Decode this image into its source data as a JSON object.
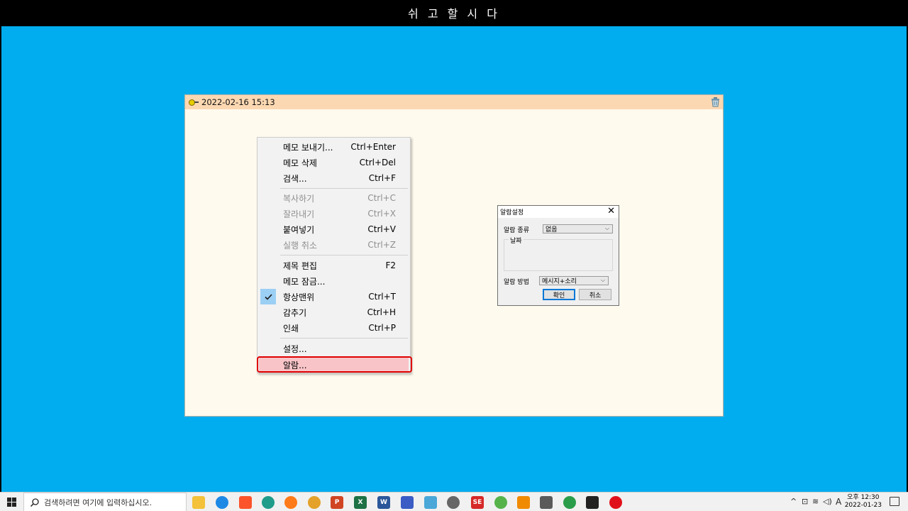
{
  "banner": {
    "title": "쉬 고 할 시 다"
  },
  "memo": {
    "date": "2022-02-16 15:13"
  },
  "context_menu": {
    "items": [
      {
        "label": "메모 보내기...",
        "shortcut": "Ctrl+Enter"
      },
      {
        "label": "메모 삭제",
        "shortcut": "Ctrl+Del"
      },
      {
        "label": "검색...",
        "shortcut": "Ctrl+F"
      },
      {
        "label": "복사하기",
        "shortcut": "Ctrl+C"
      },
      {
        "label": "잘라내기",
        "shortcut": "Ctrl+X"
      },
      {
        "label": "붙여넣기",
        "shortcut": "Ctrl+V"
      },
      {
        "label": "실행 취소",
        "shortcut": "Ctrl+Z"
      },
      {
        "label": "제목 편집",
        "shortcut": "F2"
      },
      {
        "label": "메모 잠금...",
        "shortcut": ""
      },
      {
        "label": "항상맨위",
        "shortcut": "Ctrl+T"
      },
      {
        "label": "감추기",
        "shortcut": "Ctrl+H"
      },
      {
        "label": "인쇄",
        "shortcut": "Ctrl+P"
      },
      {
        "label": "설정...",
        "shortcut": ""
      },
      {
        "label": "알람...",
        "shortcut": ""
      }
    ]
  },
  "alarm_dialog": {
    "title": "알람설정",
    "type_label": "알람 종류",
    "type_value": "없음",
    "date_group": "날짜",
    "method_label": "알람 방법",
    "method_value": "메시지+소리",
    "ok": "확인",
    "cancel": "취소"
  },
  "taskbar": {
    "search_placeholder": "검색하려면 여기에 입력하십시오.",
    "ime": "A",
    "clock_time": "오후 12:30",
    "clock_date": "2022-01-23"
  }
}
